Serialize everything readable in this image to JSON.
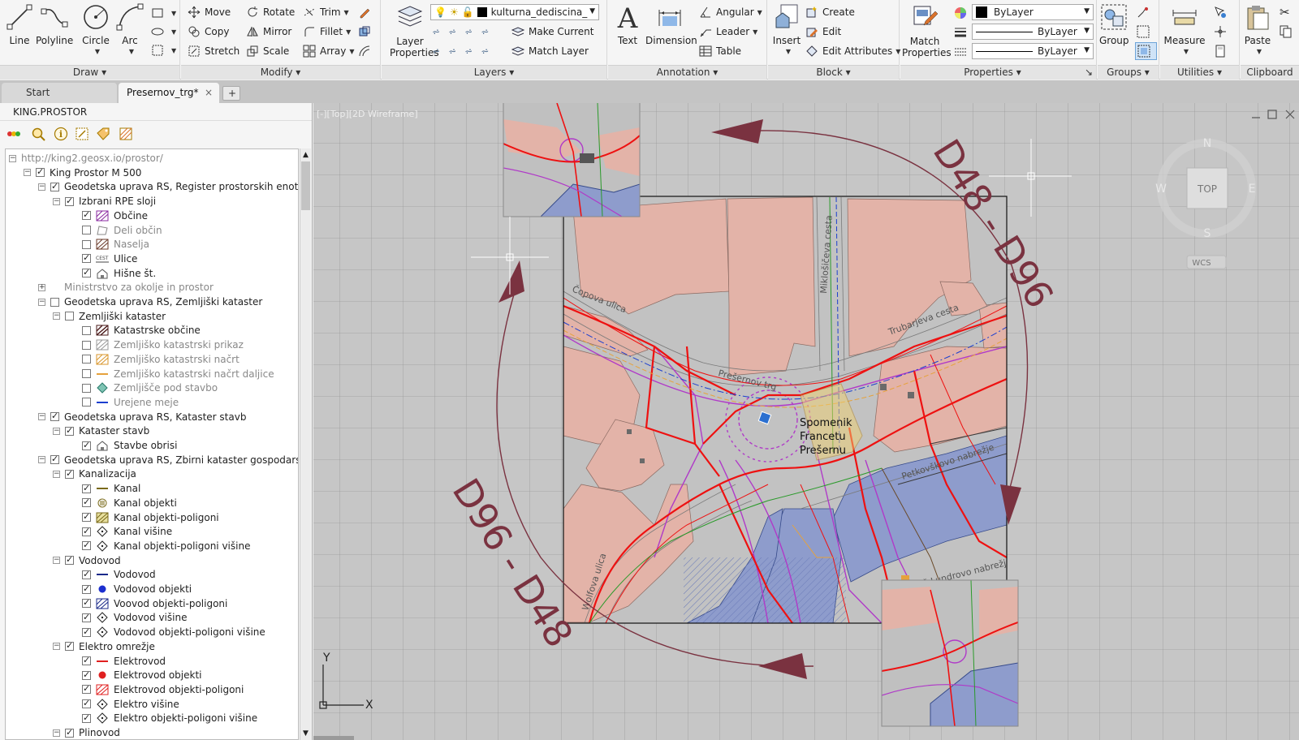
{
  "ribbon": {
    "draw": {
      "title": "Draw",
      "line": "Line",
      "polyline": "Polyline",
      "circle": "Circle",
      "arc": "Arc"
    },
    "modify": {
      "title": "Modify",
      "move": "Move",
      "rotate": "Rotate",
      "trim": "Trim",
      "copy": "Copy",
      "mirror": "Mirror",
      "fillet": "Fillet",
      "stretch": "Stretch",
      "scale": "Scale",
      "array": "Array"
    },
    "layers": {
      "title": "Layers",
      "layer_properties": "Layer Properties",
      "current_layer": "kulturna_dediscina_",
      "make_current": "Make Current",
      "match_layer": "Match Layer"
    },
    "annotation": {
      "title": "Annotation",
      "text": "Text",
      "dimension": "Dimension",
      "angular": "Angular",
      "leader": "Leader",
      "table": "Table"
    },
    "block": {
      "title": "Block",
      "insert": "Insert",
      "create": "Create",
      "edit": "Edit",
      "edit_attributes": "Edit Attributes"
    },
    "properties": {
      "title": "Properties",
      "match_properties": "Match Properties",
      "color": "ByLayer",
      "linetype": "ByLayer",
      "lineweight": "ByLayer"
    },
    "groups": {
      "title": "Groups",
      "group": "Group"
    },
    "utilities": {
      "title": "Utilities",
      "measure": "Measure"
    },
    "clipboard": {
      "title": "Clipboard",
      "paste": "Paste"
    }
  },
  "tabs": {
    "start": "Start",
    "drawing": "Presernov_trg*",
    "close": "×",
    "add": "+"
  },
  "left_panel": {
    "title": "KING.PROSTOR",
    "tree": [
      {
        "label": "http://king2.geosx.io/prostor/",
        "indent": 0,
        "exp": "-",
        "cb": "none",
        "icon": "none",
        "grey": true
      },
      {
        "label": "King Prostor M 500",
        "indent": 1,
        "exp": "-",
        "cb": "on",
        "icon": "none",
        "grey": false
      },
      {
        "label": "Geodetska uprava RS, Register prostorskih enot",
        "indent": 2,
        "exp": "-",
        "cb": "on",
        "icon": "none",
        "grey": false
      },
      {
        "label": "Izbrani RPE sloji",
        "indent": 3,
        "exp": "-",
        "cb": "on",
        "icon": "none",
        "grey": false
      },
      {
        "label": "Občine",
        "indent": 4,
        "exp": "",
        "cb": "on",
        "icon": "hatch-purple",
        "grey": false
      },
      {
        "label": "Deli občin",
        "indent": 4,
        "exp": "",
        "cb": "off",
        "icon": "outline-grey",
        "grey": true
      },
      {
        "label": "Naselja",
        "indent": 4,
        "exp": "",
        "cb": "off",
        "icon": "hatch-brown",
        "grey": true
      },
      {
        "label": "Ulice",
        "indent": 4,
        "exp": "",
        "cb": "on",
        "icon": "text-cest",
        "grey": false
      },
      {
        "label": "Hišne št.",
        "indent": 4,
        "exp": "",
        "cb": "on",
        "icon": "house",
        "grey": false
      },
      {
        "label": "Ministrstvo za okolje in prostor",
        "indent": 2,
        "exp": "+",
        "cb": "none",
        "icon": "none",
        "grey": true
      },
      {
        "label": "Geodetska uprava RS, Zemljiški kataster",
        "indent": 2,
        "exp": "-",
        "cb": "off",
        "icon": "none",
        "grey": false
      },
      {
        "label": "Zemljiški kataster",
        "indent": 3,
        "exp": "-",
        "cb": "off",
        "icon": "none",
        "grey": false
      },
      {
        "label": "Katastrske občine",
        "indent": 4,
        "exp": "",
        "cb": "off",
        "icon": "hatch-dark",
        "grey": false
      },
      {
        "label": "Zemljiško katastrski prikaz",
        "indent": 4,
        "exp": "",
        "cb": "off",
        "icon": "hatch-grey",
        "grey": true
      },
      {
        "label": "Zemljiško katastrski načrt",
        "indent": 4,
        "exp": "",
        "cb": "off",
        "icon": "hatch-orange",
        "grey": true
      },
      {
        "label": "Zemljiško katastrski načrt daljice",
        "indent": 4,
        "exp": "",
        "cb": "off",
        "icon": "line-orange",
        "grey": true
      },
      {
        "label": "Zemljišče pod stavbo",
        "indent": 4,
        "exp": "",
        "cb": "off",
        "icon": "hatch-teal",
        "grey": true
      },
      {
        "label": "Urejene meje",
        "indent": 4,
        "exp": "",
        "cb": "off",
        "icon": "line-blue",
        "grey": true
      },
      {
        "label": "Geodetska uprava RS, Kataster stavb",
        "indent": 2,
        "exp": "-",
        "cb": "on",
        "icon": "none",
        "grey": false
      },
      {
        "label": "Kataster stavb",
        "indent": 3,
        "exp": "-",
        "cb": "on",
        "icon": "none",
        "grey": false
      },
      {
        "label": "Stavbe obrisi",
        "indent": 4,
        "exp": "",
        "cb": "on",
        "icon": "house",
        "grey": false
      },
      {
        "label": "Geodetska uprava RS, Zbirni kataster gospodarske",
        "indent": 2,
        "exp": "-",
        "cb": "on",
        "icon": "none",
        "grey": false
      },
      {
        "label": "Kanalizacija",
        "indent": 3,
        "exp": "-",
        "cb": "on",
        "icon": "none",
        "grey": false
      },
      {
        "label": "Kanal",
        "indent": 4,
        "exp": "",
        "cb": "on",
        "icon": "line-olive",
        "grey": false
      },
      {
        "label": "Kanal objekti",
        "indent": 4,
        "exp": "",
        "cb": "on",
        "icon": "circle-olive",
        "grey": false
      },
      {
        "label": "Kanal objekti-poligoni",
        "indent": 4,
        "exp": "",
        "cb": "on",
        "icon": "hatch-olive",
        "grey": false
      },
      {
        "label": "Kanal višine",
        "indent": 4,
        "exp": "",
        "cb": "on",
        "icon": "diamond",
        "grey": false
      },
      {
        "label": "Kanal objekti-poligoni višine",
        "indent": 4,
        "exp": "",
        "cb": "on",
        "icon": "diamond",
        "grey": false
      },
      {
        "label": "Vodovod",
        "indent": 3,
        "exp": "-",
        "cb": "on",
        "icon": "none",
        "grey": false
      },
      {
        "label": "Vodovod",
        "indent": 4,
        "exp": "",
        "cb": "on",
        "icon": "line-navy",
        "grey": false
      },
      {
        "label": "Vodovod objekti",
        "indent": 4,
        "exp": "",
        "cb": "on",
        "icon": "dot-blue",
        "grey": false
      },
      {
        "label": "Voovod objekti-poligoni",
        "indent": 4,
        "exp": "",
        "cb": "on",
        "icon": "hatch-navy",
        "grey": false
      },
      {
        "label": "Vodovod višine",
        "indent": 4,
        "exp": "",
        "cb": "on",
        "icon": "diamond",
        "grey": false
      },
      {
        "label": "Vodovod objekti-poligoni višine",
        "indent": 4,
        "exp": "",
        "cb": "on",
        "icon": "diamond",
        "grey": false
      },
      {
        "label": "Elektro omrežje",
        "indent": 3,
        "exp": "-",
        "cb": "on",
        "icon": "none",
        "grey": false
      },
      {
        "label": "Elektrovod",
        "indent": 4,
        "exp": "",
        "cb": "on",
        "icon": "line-red",
        "grey": false
      },
      {
        "label": "Elektrovod objekti",
        "indent": 4,
        "exp": "",
        "cb": "on",
        "icon": "dot-red",
        "grey": false
      },
      {
        "label": "Elektrovod objekti-poligoni",
        "indent": 4,
        "exp": "",
        "cb": "on",
        "icon": "hatch-red",
        "grey": false
      },
      {
        "label": "Elektro višine",
        "indent": 4,
        "exp": "",
        "cb": "on",
        "icon": "diamond",
        "grey": false
      },
      {
        "label": "Elektro objekti-poligoni višine",
        "indent": 4,
        "exp": "",
        "cb": "on",
        "icon": "diamond",
        "grey": false
      },
      {
        "label": "Plinovod",
        "indent": 3,
        "exp": "-",
        "cb": "on",
        "icon": "none",
        "grey": false
      }
    ]
  },
  "viewport": {
    "label": "[-][Top][2D Wireframe]",
    "transform_top": "D48 - D96",
    "transform_bottom": "D96 - D48",
    "monument_l1": "Spomenik",
    "monument_l2": "Francetu",
    "monument_l3": "Prešernu",
    "street_copova": "Čopova ulica",
    "street_miklosiceva": "Miklošičeva cesta",
    "street_trubarjeva": "Trubarjeva cesta",
    "street_presernov": "Prešernov trg",
    "street_petkovskovo": "Petkovškovo nabrežje",
    "street_adamic": "Adamič-Lundrovo nabrežje",
    "street_wolfova": "Wolfova ulica",
    "viewcube_top": "TOP",
    "compass_n": "N",
    "compass_s": "S",
    "compass_e": "E",
    "compass_w": "W",
    "wcs": "WCS",
    "ucs_x": "X",
    "ucs_y": "Y"
  },
  "colors": {
    "transform_arrow": "#7a3240",
    "building": "#e3b3a8",
    "water": "#8e9ccc",
    "electro": "#ee1111",
    "gas": "#b03ac8",
    "grid": "#9a9a9a",
    "canvas": "#c6c6c6"
  }
}
